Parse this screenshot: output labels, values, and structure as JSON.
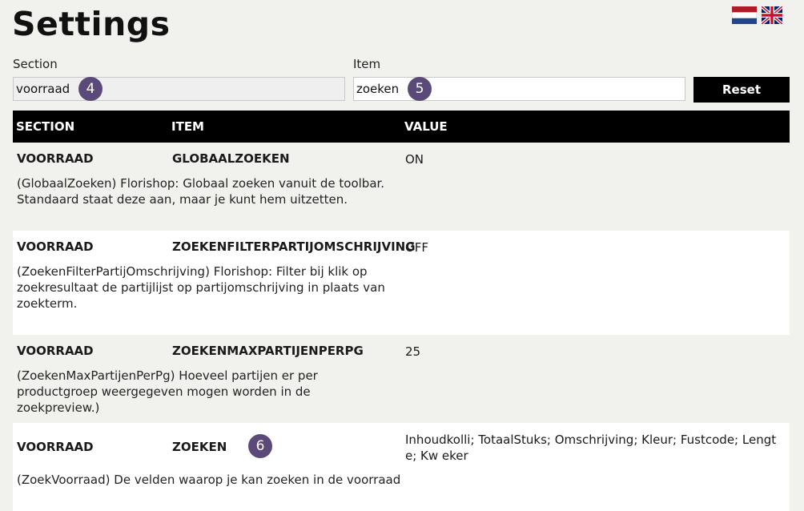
{
  "page": {
    "title": "Settings"
  },
  "filters": {
    "section_label": "Section",
    "section_value": "voorraad",
    "item_label": "Item",
    "item_value": "zoeken",
    "reset_label": "Reset"
  },
  "badges": {
    "section": "4",
    "item": "5",
    "row": "6"
  },
  "flags": [
    "dutch-flag-icon",
    "uk-flag-icon"
  ],
  "table": {
    "headers": [
      "SECTION",
      "ITEM",
      "VALUE"
    ],
    "rows": [
      {
        "section": "VOORRAAD",
        "item": "GLOBAALZOEKEN",
        "value": "ON",
        "description": "(GlobaalZoeken) Florishop: Globaal zoeken vanuit de toolbar. Standaard staat deze aan, maar je kunt hem uitzetten."
      },
      {
        "section": "VOORRAAD",
        "item": "ZOEKENFILTERPARTIJOMSCHRIJVING",
        "value": "OFF",
        "description": "(ZoekenFilterPartijOmschrijving) Florishop: Filter bij klik op zoekresultaat de partijlijst op partijomschrijving in plaats van zoekterm."
      },
      {
        "section": "VOORRAAD",
        "item": "ZOEKENMAXPARTIJENPERPG",
        "value": "25",
        "description": "(ZoekenMaxPartijenPerPg) Hoeveel partijen er per productgroep weergegeven mogen worden in de zoekpreview.)"
      },
      {
        "section": "VOORRAAD",
        "item": "ZOEKEN",
        "value": "Inhoudkolli; TotaalStuks; Omschrijving; Kleur; Fustcode; Lengte; Kw eker",
        "description": "(ZoekVoorraad) De velden waarop je kan zoeken in de voorraad"
      }
    ]
  },
  "colors": {
    "header_bg": "#000000",
    "badge": "#5b4a79",
    "page_bg": "#f1f2ee",
    "row_alt": "#ffffff"
  }
}
